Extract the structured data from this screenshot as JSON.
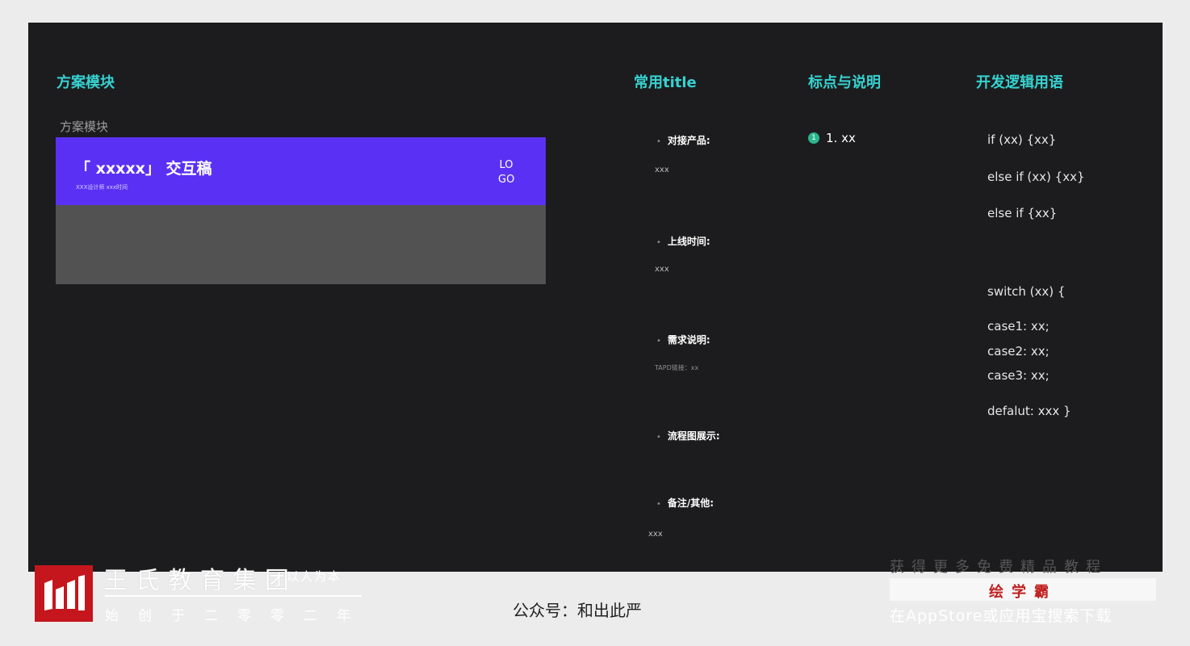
{
  "columns": {
    "plan": "方案模块",
    "title": "常用title",
    "punct": "标点与说明",
    "dev": "开发逻辑用语"
  },
  "plan": {
    "sub_label": "方案模块",
    "cover_title": "「 xxxxx」 交互稿",
    "cover_meta": "XXX设计师   xxx时间",
    "logo": "LO GO"
  },
  "title_rows": [
    {
      "label": "对接产品:",
      "value": "xxx"
    },
    {
      "label": "上线时间:",
      "value": "xxx"
    },
    {
      "label": "需求说明:",
      "value": "TAPD链接：xx"
    },
    {
      "label": "流程图展示:",
      "value": ""
    },
    {
      "label": "备注/其他:",
      "value": "xxx"
    }
  ],
  "punct": {
    "number": "1",
    "text": "1. xx"
  },
  "code_lines": [
    "if (xx) {xx}",
    "else if  (xx) {xx}",
    "else if  {xx}",
    "switch (xx)  {",
    "case1: xx;",
    "case2: xx;",
    "case3: xx;",
    "defalut: xxx }"
  ],
  "watermark": {
    "org_name": "王氏教育集团",
    "motto": "以人为本",
    "since": "始创于二零零二年",
    "wechat": "公众号：和出此严",
    "promo_line1": "获得更多免费精品教程",
    "promo_brand": "绘学霸",
    "promo_line3": "在AppStore或应用宝搜索下载"
  }
}
